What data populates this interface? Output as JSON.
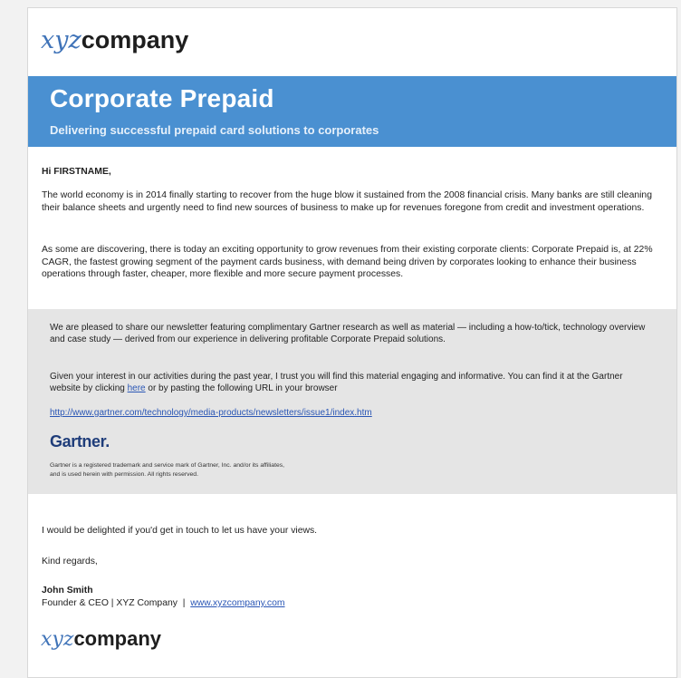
{
  "logo": {
    "xyz": "xyz",
    "company": "company"
  },
  "banner": {
    "title": "Corporate Prepaid",
    "subtitle": "Delivering successful prepaid card solutions to corporates"
  },
  "body": {
    "greeting": "Hi FIRSTNAME,",
    "paragraph1": "The world economy is in 2014 finally starting to recover from the huge blow it sustained from the 2008 financial crisis. Many banks are still cleaning their balance sheets and urgently need to find new sources of business to make up for revenues foregone from credit and investment operations.",
    "paragraph2": "As some are discovering, there is today an exciting opportunity to grow revenues from their existing corporate clients: Corporate Prepaid is, at 22% CAGR, the fastest growing segment of the payment cards business, with demand being driven by corporates looking to enhance their business operations through faster, cheaper, more flexible and more secure payment processes."
  },
  "newsletter": {
    "paragraph1": "We are pleased to share our newsletter featuring complimentary Gartner research as well as material — including a how-to/tick, technology overview and case study — derived from our experience in delivering profitable Corporate Prepaid solutions.",
    "paragraph2_a": "Given your interest in our activities during the past year, I trust you will find this material engaging and informative. You can find it at the Gartner website by clicking ",
    "link_here": "here",
    "paragraph2_b": " or by pasting the following URL in your browser",
    "url": "http://www.gartner.com/technology/media-products/newsletters/issue1/index.htm",
    "gartner_logo": "Gartner",
    "gartner_logo_dot": ".",
    "disclaimer_line1": "Gartner is a registered trademark and service mark of Gartner, Inc. and/or its affiliates,",
    "disclaimer_line2": "and is used herein with permission. All rights reserved."
  },
  "closing": {
    "line": "I would be delighted if you'd get in touch to let us have your views.",
    "regards": "Kind regards,",
    "name": "John Smith",
    "title": "Founder & CEO | XYZ Company",
    "separator": "|",
    "website": "www.xyzcompany.com"
  },
  "colors": {
    "banner": "#4a90d1",
    "logo_xyz": "#3f73b8",
    "gray_panel": "#e5e5e5",
    "link": "#2a56b5"
  }
}
